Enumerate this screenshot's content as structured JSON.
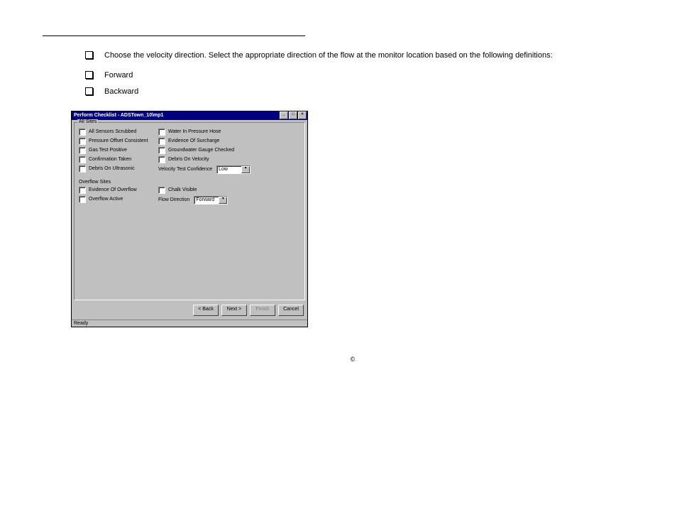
{
  "header": {
    "page_info": ""
  },
  "list": {
    "items": [
      {
        "text": "Choose the velocity direction. Select the appropriate direction of the flow at the monitor location based on the following definitions:"
      },
      {
        "text": "Forward",
        "sub": true
      },
      {
        "text": "Backward",
        "sub": true
      }
    ]
  },
  "window": {
    "title": "Perform Checklist - ADSTown_10\\mp1",
    "group1_label": "All Sites",
    "col1": [
      "All Sensors Scrubbed",
      "Pressure Offset Consistent",
      "Gas Test Positive",
      "Confirmation Taken",
      "Debris On Ultrasonic"
    ],
    "col2": [
      "Water In Pressure Hose",
      "Evidence Of Surcharge",
      "Groundwater Gauge Checked",
      "Debris On Velocity"
    ],
    "velocity_label": "Velocity Test Confidence",
    "velocity_value": "Low",
    "overflow_label": "Overflow Sites",
    "overflow_col1": [
      "Evidence Of Overflow",
      "Overflow Active"
    ],
    "overflow_col2": [
      "Chalk Visible"
    ],
    "flow_label": "Flow Direction",
    "flow_value": "Forward",
    "buttons": {
      "back": "< Back",
      "next": "Next >",
      "finish": "Finish",
      "cancel": "Cancel"
    },
    "status": "Ready",
    "title_min": "_",
    "title_max": "□",
    "title_close": "×",
    "combo_arrow": "▾"
  },
  "footer": {
    "symbol": "©"
  }
}
